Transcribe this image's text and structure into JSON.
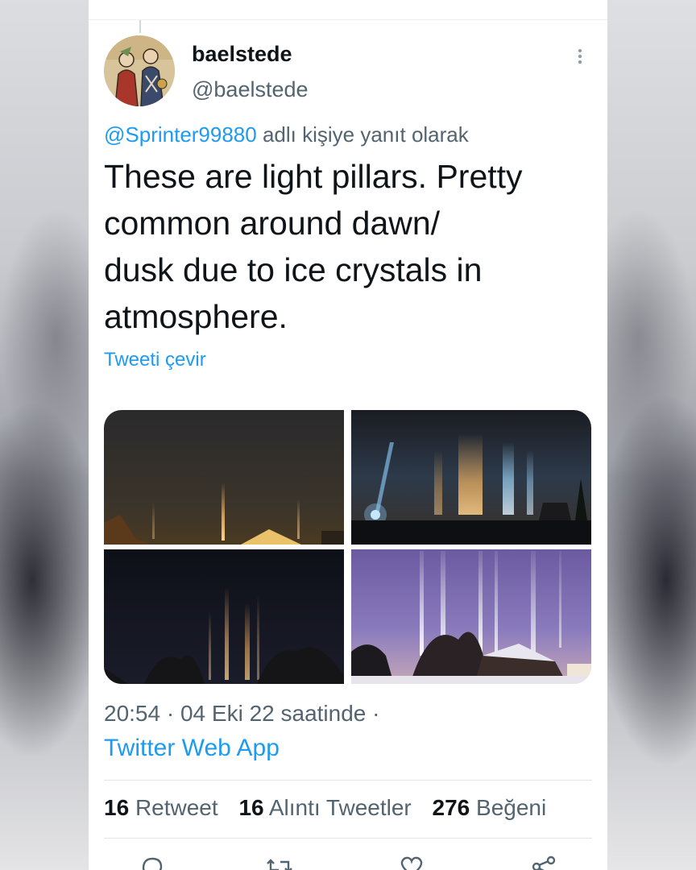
{
  "tweet": {
    "display_name": "baelstede",
    "handle": "@baelstede",
    "reply_to_mention": "@Sprinter99880",
    "reply_to_suffix": "adlı kişiye yanıt olarak",
    "text_lines": [
      "These are light pillars. Pretty",
      "common around dawn/",
      "dusk due to ice crystals in",
      "atmosphere."
    ],
    "translate_label": "Tweeti çevir",
    "time": "20:54",
    "date": "04 Eki 22 saatinde",
    "source": "Twitter Web App",
    "stats": {
      "retweets_count": "16",
      "retweets_label": "Retweet",
      "quotes_count": "16",
      "quotes_label": "Alıntı Tweetler",
      "likes_count": "276",
      "likes_label": "Beğeni"
    },
    "media": [
      {
        "icon": "light-pillars-photo-1"
      },
      {
        "icon": "light-pillars-photo-2"
      },
      {
        "icon": "light-pillars-photo-3"
      },
      {
        "icon": "light-pillars-photo-4"
      }
    ],
    "actions": [
      "reply-icon",
      "retweet-icon",
      "like-icon",
      "share-icon"
    ]
  },
  "colors": {
    "accent": "#1d9bf0",
    "text": "#0f1419",
    "secondary": "#536471"
  }
}
